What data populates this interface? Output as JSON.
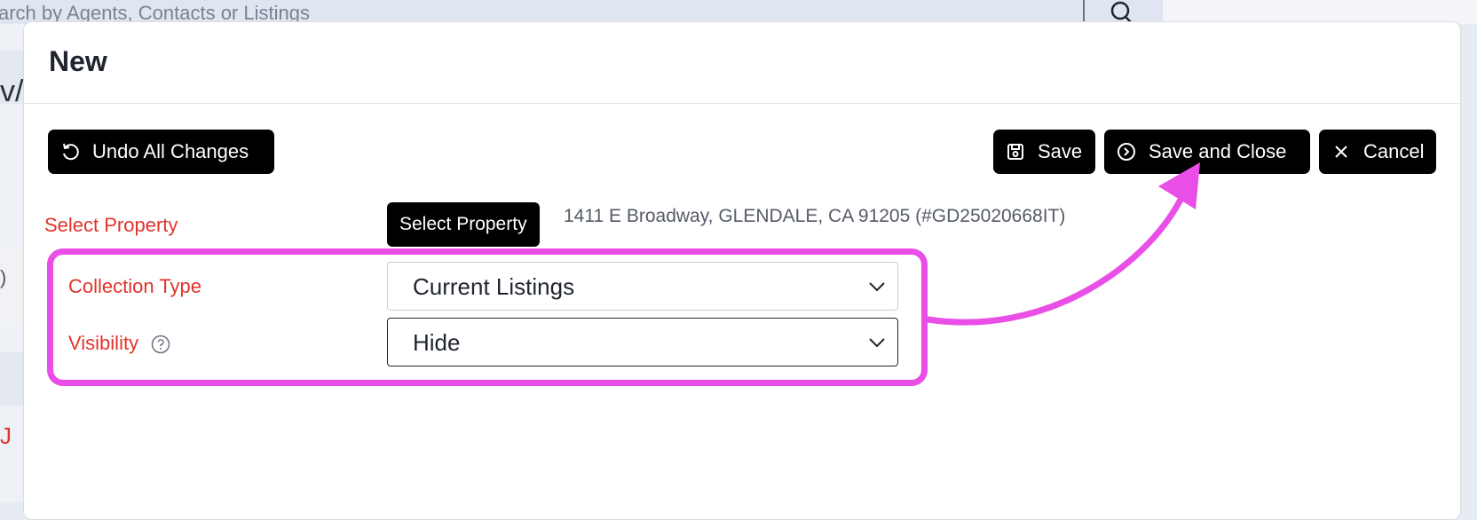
{
  "background": {
    "search_placeholder": "arch by Agents, Contacts or Listings",
    "left_glyph_1": "v/",
    "left_glyph_2": ")",
    "left_glyph_3": "J"
  },
  "dialog": {
    "title": "New",
    "toolbar": {
      "undo_label": "Undo All Changes",
      "save_label": "Save",
      "save_close_label": "Save and Close",
      "cancel_label": "Cancel"
    },
    "fields": {
      "property": {
        "label": "Select Property",
        "button_label": "Select Property",
        "value": "1411 E Broadway, GLENDALE, CA 91205 (#GD25020668IT)"
      },
      "collection_type": {
        "label": "Collection Type",
        "selected": "Current Listings"
      },
      "visibility": {
        "label": "Visibility",
        "selected": "Hide"
      }
    }
  },
  "colors": {
    "label_red": "#e0342b",
    "annotation_magenta": "#e94fe6",
    "button_black": "#000000"
  },
  "icons": [
    "search-icon",
    "undo-icon",
    "save-icon",
    "arrow-right-circle-icon",
    "close-icon",
    "help-icon",
    "chevron-down-icon"
  ]
}
